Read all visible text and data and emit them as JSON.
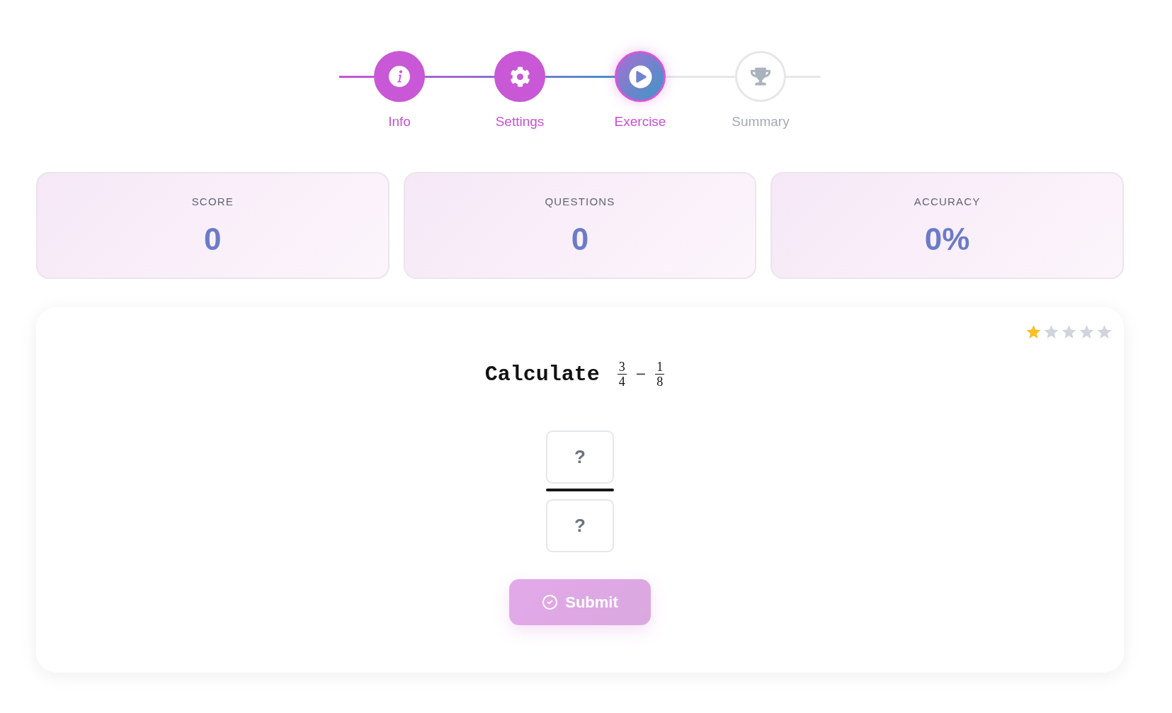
{
  "stepper": {
    "steps": [
      {
        "label": "Info",
        "completed": true,
        "selected": false
      },
      {
        "label": "Settings",
        "completed": true,
        "selected": false
      },
      {
        "label": "Exercise",
        "completed": false,
        "selected": true
      },
      {
        "label": "Summary",
        "completed": false,
        "selected": false
      }
    ]
  },
  "stats": [
    {
      "label": "SCORE",
      "value": "0"
    },
    {
      "label": "QUESTIONS",
      "value": "0"
    },
    {
      "label": "ACCURACY",
      "value": "0%"
    }
  ],
  "exercise": {
    "difficulty": {
      "stars": 1
    },
    "question": {
      "prompt": "Calculate",
      "expression": [
        {
          "kind": "fraction",
          "numerator": "3",
          "denominator": "4"
        },
        {
          "kind": "operator",
          "text": "−"
        },
        {
          "kind": "fraction",
          "numerator": "1",
          "denominator": "8"
        }
      ]
    },
    "answer": {
      "numerator": {
        "placeholder": "?"
      },
      "denominator": {
        "placeholder": "?"
      }
    },
    "submit": {
      "label": "Submit",
      "disabled": true
    }
  }
}
